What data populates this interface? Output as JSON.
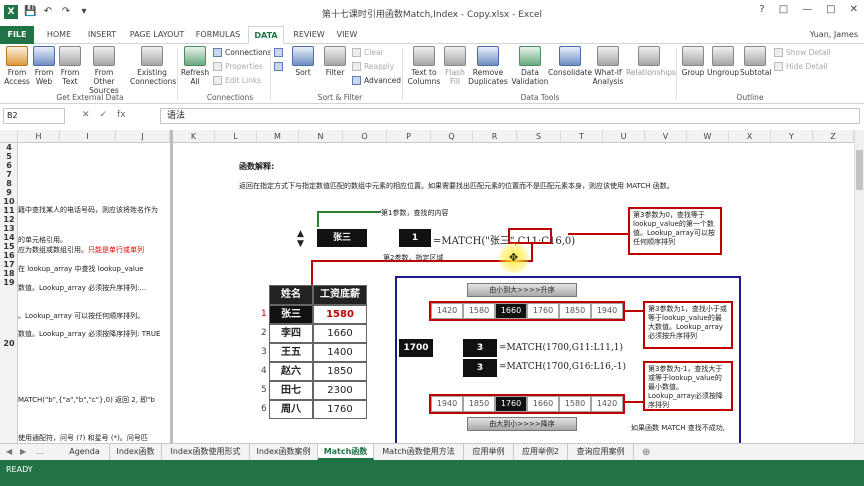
{
  "window": {
    "title": "第十七课时引用函数Match,Index - Copy.xlsx - Excel",
    "user": "Yuan, James",
    "controls": [
      "?",
      "□",
      "—",
      "□",
      "✕"
    ]
  },
  "ribbon_tabs": [
    "FILE",
    "HOME",
    "INSERT",
    "PAGE LAYOUT",
    "FORMULAS",
    "DATA",
    "REVIEW",
    "VIEW"
  ],
  "ribbon": {
    "get_external": {
      "label": "Get External Data",
      "buttons": [
        "From Access",
        "From Web",
        "From Text",
        "From Other Sources",
        "Existing Connections"
      ]
    },
    "connections": {
      "label": "Connections",
      "refresh": "Refresh All",
      "items": [
        "Connections",
        "Properties",
        "Edit Links"
      ]
    },
    "sort_filter": {
      "label": "Sort & Filter",
      "sort": "Sort",
      "filter": "Filter",
      "items": [
        "Clear",
        "Reapply",
        "Advanced"
      ]
    },
    "data_tools": {
      "label": "Data Tools",
      "buttons": [
        "Text to Columns",
        "Flash Fill",
        "Remove Duplicates",
        "Data Validation",
        "Consolidate",
        "What-If Analysis",
        "Relationships"
      ]
    },
    "outline": {
      "label": "Outline",
      "buttons": [
        "Group",
        "Ungroup",
        "Subtotal"
      ],
      "items": [
        "Show Detail",
        "Hide Detail"
      ]
    }
  },
  "formula_bar": {
    "name_box": "B2",
    "icons": [
      "✕",
      "✓",
      "fx"
    ],
    "value": "语法"
  },
  "grid": {
    "left_columns": [
      "H",
      "I",
      "J"
    ],
    "right_columns": [
      "K",
      "L",
      "M",
      "N",
      "O",
      "P",
      "Q",
      "R",
      "S",
      "T",
      "U",
      "V",
      "W",
      "X",
      "Y",
      "Z"
    ],
    "row_numbers": [
      "4",
      "5",
      "6",
      "7",
      "8",
      "9",
      "10",
      "11",
      "12",
      "13",
      "14",
      "15",
      "16",
      "17",
      "18",
      "19",
      "20"
    ],
    "left_text": [
      {
        "text": "籍中查找某人的电话号码，则应该将姓名作为",
        "red": false
      },
      {
        "text": "的单元格引用。",
        "red": false
      },
      {
        "text": "应为数组或数组引用。只能是单行或单列",
        "red": false
      },
      {
        "text": "在 lookup_array 中查找 lookup_value",
        "red": false
      },
      {
        "text": "数值。Lookup_array 必须按升序排列:...",
        "red": false
      },
      {
        "text": "。Lookup_array 可以按任何顺序排列。",
        "red": false
      },
      {
        "text": "数值。Lookup_array 必须按降序排列: TRUE",
        "red": false
      },
      {
        "text": "MATCH(\"b\",{\"a\",\"b\",\"c\"},0) 返回 2, 即\"b",
        "red": false
      },
      {
        "text": "使用通配符，问号 (?) 和星号 (*)。问号匹",
        "red": false
      }
    ],
    "left_red_fragment": "只能是单行或单列"
  },
  "content": {
    "title": "函数解释:",
    "description": "返回在指定方式下与指定数值匹配的数组中元素的相应位置。如果需要找出匹配元素的位置而不是匹配元素本身，则应该使用 MATCH 函数。",
    "param1_label": "第1参数，查找的内容",
    "param2_label": "第2参数，指定区域",
    "lookup_name": "张三",
    "result_1": "1",
    "formula_main": "=MATCH(\"张三\",C11:C16,0)",
    "note_param3_zero": "第3参数为0，查找等于lookup_value的第一个数值。Lookup_array可以按任何顺序排列",
    "table": {
      "headers": [
        "姓名",
        "工资底薪"
      ],
      "row_index": [
        "1",
        "2",
        "3",
        "4",
        "5",
        "6"
      ],
      "names": [
        "张三",
        "李四",
        "王五",
        "赵六",
        "田七",
        "周八"
      ],
      "salaries": [
        "1580",
        "1660",
        "1400",
        "1850",
        "2300",
        "1760"
      ]
    },
    "asc": {
      "label": "由小到大>>>>升序",
      "values": [
        "1420",
        "1580",
        "1660",
        "1760",
        "1850",
        "1940"
      ],
      "selected_index": 2
    },
    "desc": {
      "label": "由大到小>>>>降序",
      "values": [
        "1940",
        "1850",
        "1760",
        "1660",
        "1580",
        "1420"
      ],
      "selected_index": 2
    },
    "lookup_value": "1700",
    "result_asc": "3",
    "formula_asc": "=MATCH(1700,G11:L11,1)",
    "result_desc": "3",
    "formula_desc": "=MATCH(1700,G16:L16,-1)",
    "note_param3_pos": "第3参数为1，查找小于或等于lookup_value的最大数值。Lookup_array必须按升序排列",
    "note_param3_neg": "第3参数为-1，查找大于或等于lookup_value的最小数值。Lookup_array必须按降序排列",
    "footer_note": "如果函数 MATCH 查找不成功,"
  },
  "sheets": {
    "tabs": [
      "Agenda",
      "Index函数",
      "Index函数使用形式",
      "Index函数案例",
      "Match函数",
      "Match函数使用方法",
      "应用举例",
      "应用举例2",
      "查询应用案例"
    ],
    "active_index": 4
  },
  "status": "READY",
  "colors": {
    "excel_green": "#217346",
    "accent_red": "#c00000",
    "navy": "#1a1a8c"
  }
}
